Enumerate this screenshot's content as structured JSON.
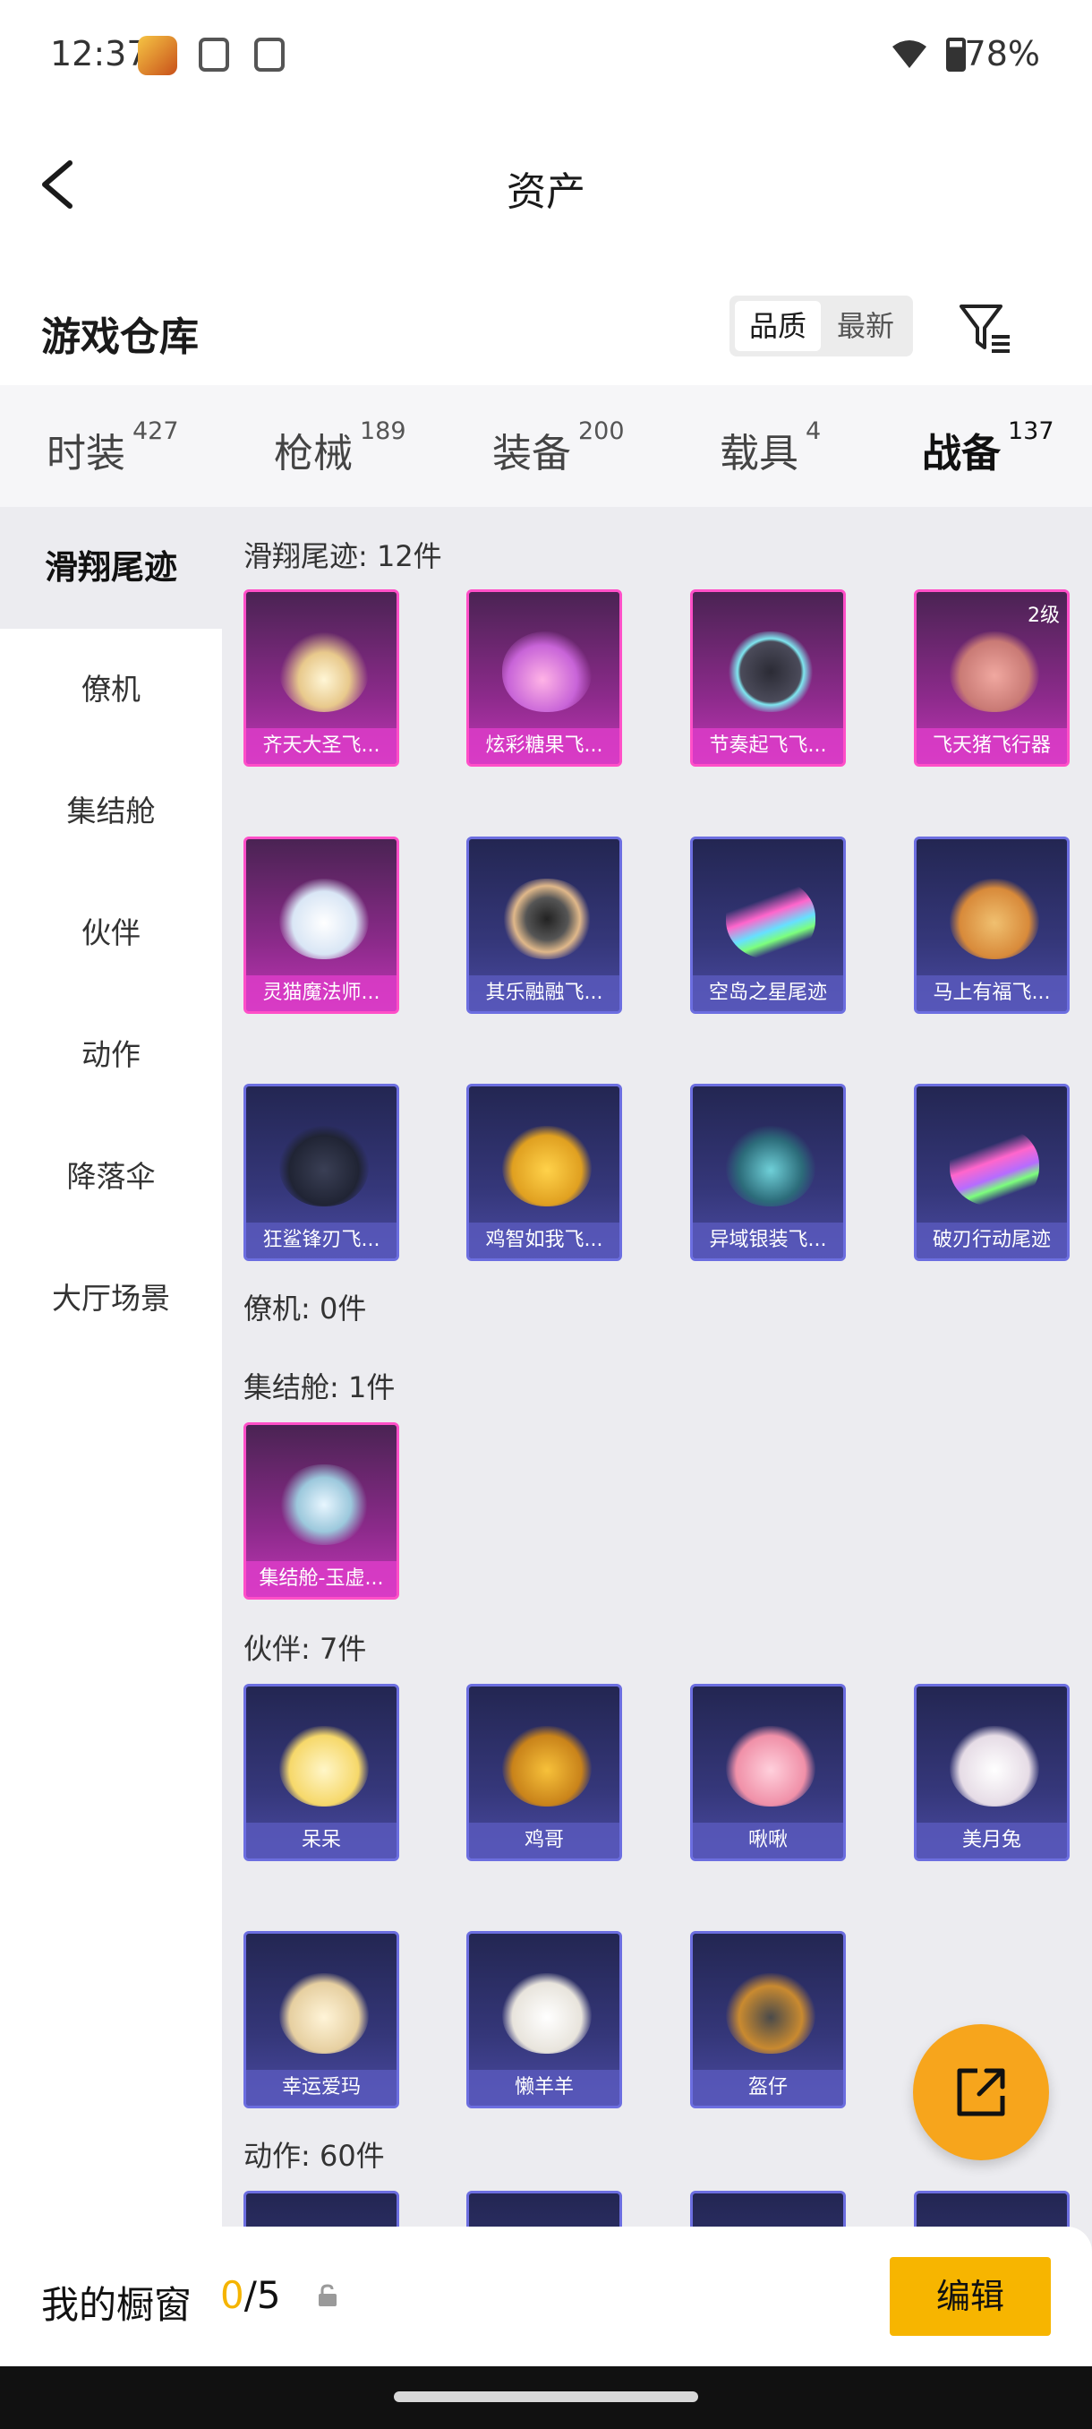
{
  "status_bar": {
    "time": "12:37",
    "battery": "78%"
  },
  "header": {
    "title": "资产"
  },
  "warehouse": {
    "title": "游戏仓库",
    "sort_options": [
      "品质",
      "最新"
    ],
    "active_sort": "品质"
  },
  "category_tabs": [
    {
      "label": "时装",
      "count": "427"
    },
    {
      "label": "枪械",
      "count": "189"
    },
    {
      "label": "装备",
      "count": "200"
    },
    {
      "label": "载具",
      "count": "4"
    },
    {
      "label": "战备",
      "count": "137"
    }
  ],
  "active_tab": "战备",
  "sidebar": [
    "滑翔尾迹",
    "僚机",
    "集结舱",
    "伙伴",
    "动作",
    "降落伞",
    "大厅场景"
  ],
  "active_sidebar": "滑翔尾迹",
  "sections": {
    "glide": {
      "title": "滑翔尾迹: 12件"
    },
    "wingman": {
      "title": "僚机: 0件"
    },
    "pod": {
      "title": "集结舱: 1件"
    },
    "partner": {
      "title": "伙伴: 7件"
    },
    "action": {
      "title": "动作: 60件"
    }
  },
  "glide_items": [
    {
      "name": "齐天大圣飞...",
      "quality": "pink"
    },
    {
      "name": "炫彩糖果飞...",
      "quality": "pink"
    },
    {
      "name": "节奏起飞飞...",
      "quality": "pink"
    },
    {
      "name": "飞天猪飞行器",
      "quality": "pink",
      "badge": "2级"
    },
    {
      "name": "灵猫魔法师...",
      "quality": "pink"
    },
    {
      "name": "其乐融融飞...",
      "quality": "blue"
    },
    {
      "name": "空岛之星尾迹",
      "quality": "blue"
    },
    {
      "name": "马上有福飞...",
      "quality": "blue"
    },
    {
      "name": "狂鲨锋刃飞...",
      "quality": "blue"
    },
    {
      "name": "鸡智如我飞...",
      "quality": "blue"
    },
    {
      "name": "异域银装飞...",
      "quality": "blue"
    },
    {
      "name": "破刃行动尾迹",
      "quality": "blue"
    }
  ],
  "pod_items": [
    {
      "name": "集结舱-玉虚...",
      "quality": "pink"
    }
  ],
  "partner_items": [
    {
      "name": "呆呆",
      "quality": "blue"
    },
    {
      "name": "鸡哥",
      "quality": "blue"
    },
    {
      "name": "啾啾",
      "quality": "blue"
    },
    {
      "name": "美月兔",
      "quality": "blue"
    },
    {
      "name": "幸运爱玛",
      "quality": "blue"
    },
    {
      "name": "懒羊羊",
      "quality": "blue"
    },
    {
      "name": "盔仔",
      "quality": "blue"
    }
  ],
  "showcase": {
    "label": "我的橱窗",
    "current": "0",
    "total": "/5",
    "edit_label": "编辑"
  },
  "colors": {
    "accent": "#f5b400",
    "fab": "#f7a51c",
    "pink_quality": "#c036b5",
    "blue_quality": "#4a4aa2"
  }
}
